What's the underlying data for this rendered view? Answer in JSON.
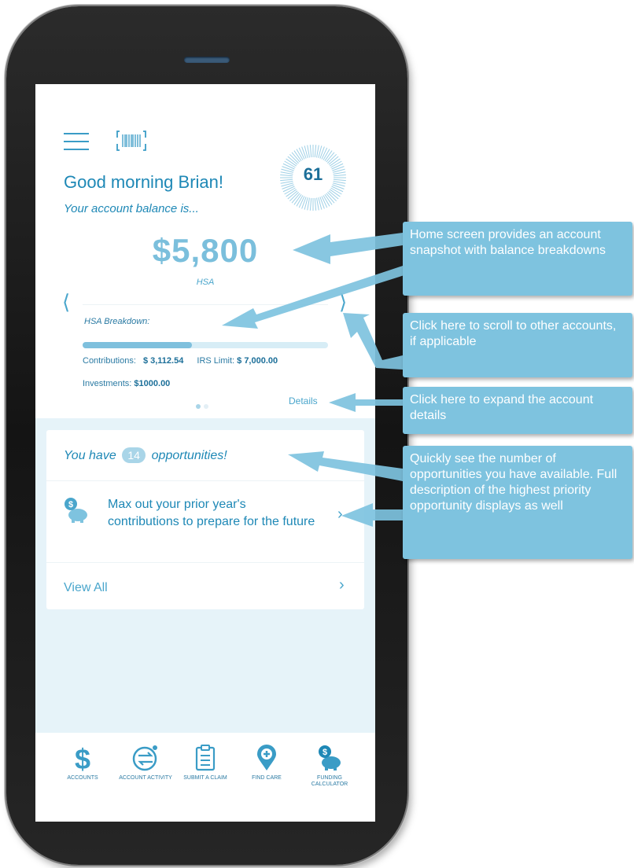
{
  "home": {
    "greeting": "Good morning Brian!",
    "balance_intro": "Your account balance is...",
    "score": "61",
    "balance": "$5,800",
    "account_type": "HSA",
    "breakdown_title": "HSA Breakdown:",
    "contributions_label": "Contributions:",
    "contributions_value": "$ 3,112.54",
    "irs_limit_label": "IRS Limit:",
    "irs_limit_value": "$ 7,000.00",
    "investments_label": "Investments:",
    "investments_value": "$1000.00",
    "contribution_progress": 0.445,
    "details_link": "Details",
    "page_count": 2,
    "current_page": 1
  },
  "opportunities": {
    "prefix": "You have",
    "count": "14",
    "suffix": "opportunities!",
    "top_item": "Max out your prior year's contributions to prepare for the future",
    "view_all": "View All"
  },
  "tabbar": [
    {
      "label": "ACCOUNTS",
      "icon": "dollar-icon"
    },
    {
      "label": "ACCOUNT ACTIVITY",
      "icon": "activity-icon"
    },
    {
      "label": "SUBMIT A CLAIM",
      "icon": "clipboard-icon"
    },
    {
      "label": "FIND CARE",
      "icon": "location-pin-icon"
    },
    {
      "label": "FUNDING CALCULATOR",
      "icon": "piggy-bank-icon"
    }
  ],
  "callouts": [
    "Home screen provides an account snapshot with balance breakdowns",
    "Click here to scroll to other accounts, if applicable",
    "Click here to expand the account details",
    "Quickly see the number of opportunities you have available. Full description of the highest priority opportunity displays as well"
  ],
  "colors": {
    "primary": "#1e88b6",
    "light": "#7ec3df",
    "background": "#e6f3f9"
  }
}
